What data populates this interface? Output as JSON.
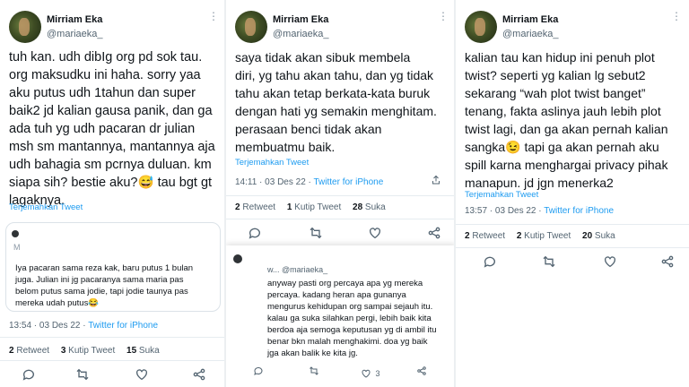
{
  "author": {
    "name": "Mirriam Eka",
    "handle": "@mariaeka_"
  },
  "icons": {
    "more": "more-icon",
    "reply": "reply-icon",
    "retweet": "retweet-icon",
    "like": "like-icon",
    "share": "share-icon",
    "avatar": "avatar-image"
  },
  "colors": {
    "link": "#1d9bf0",
    "muted": "#536471",
    "text": "#0f1419"
  },
  "tweet1": {
    "text": "tuh kan. udh dibIg org pd sok tau.\norg maksudku ini haha. sorry yaa\naku putus udh 1tahun dan super\nbaik2 jd kalian gausa panik, dan ga\nada tuh yg udh pacaran dr julian\nmsh sm mantannya, mantannya aja\nudh bahagia sm pcrnya duluan. km\nsiapa sih? bestie aku?😅 tau bgt gt\nlagaknya.",
    "translate": "Terjemahkan Tweet",
    "quote": {
      "meta": "M",
      "text": "Iya pacaran sama reza kak, baru putus 1 bulan\njuga. Julian ini jg pacaranya sama maria pas\nbelom putus sama jodie, tapi jodie taunya pas\nmereka udah putus😂"
    },
    "time": "13:54 · 03 Des 22 · ",
    "source": "Twitter for iPhone",
    "retweets": "2",
    "retweets_label": "Retweet",
    "quotes": "3",
    "quotes_label": "Kutip Tweet",
    "likes": "15",
    "likes_label": "Suka"
  },
  "tweet2": {
    "text": "saya tidak akan sibuk membela\ndiri, yg tahu akan tahu, dan yg tidak\ntahu akan tetap berkata-kata buruk\ndengan hati yg semakin menghitam.\nperasaan benci tidak akan\nmembuatmu baik.",
    "translate": "Terjemahkan Tweet",
    "time": "14:11 · 03 Des 22 · ",
    "source": "Twitter for iPhone",
    "retweets": "2",
    "retweets_label": "Retweet",
    "quotes": "1",
    "quotes_label": "Kutip Tweet",
    "likes": "28",
    "likes_label": "Suka",
    "reply": {
      "handle": "w... @mariaeka_",
      "text": "anyway pasti org percaya apa yg mereka\npercaya. kadang heran apa gunanya\nmengurus kehidupan org sampai sejauh itu.\nkalau ga suka silahkan pergi, lebih baik kita\nberdoa aja semoga keputusan yg di ambil itu\nbenar bkn malah menghakimi. doa yg baik\njga akan balik ke kita jg.",
      "likes": "3"
    }
  },
  "tweet3": {
    "text": "kalian tau kan hidup ini penuh plot\ntwist? seperti yg kalian lg sebut2\nsekarang “wah plot twist banget”\ntenang, fakta aslinya jauh lebih plot\ntwist lagi, dan ga akan pernah kalian\nsangka😉 tapi ga akan pernah aku\nspill karna menghargai privacy pihak\nmanapun. jd jgn menerka2",
    "translate": "Terjemahkan Tweet",
    "time": "13:57 · 03 Des 22 · ",
    "source": "Twitter for iPhone",
    "retweets": "2",
    "retweets_label": "Retweet",
    "quotes": "2",
    "quotes_label": "Kutip Tweet",
    "likes": "20",
    "likes_label": "Suka"
  }
}
